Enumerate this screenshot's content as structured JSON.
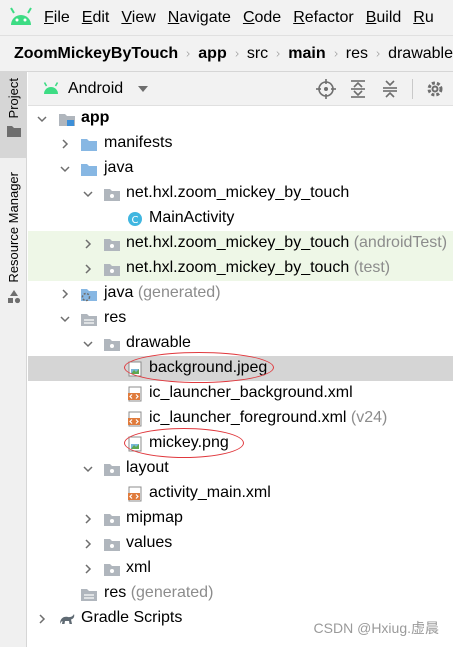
{
  "menubar": {
    "items": [
      {
        "mnemonic": "F",
        "rest": "ile"
      },
      {
        "mnemonic": "E",
        "rest": "dit"
      },
      {
        "mnemonic": "V",
        "rest": "iew"
      },
      {
        "mnemonic": "N",
        "rest": "avigate"
      },
      {
        "mnemonic": "C",
        "rest": "ode"
      },
      {
        "mnemonic": "R",
        "rest": "efactor"
      },
      {
        "mnemonic": "B",
        "rest": "uild"
      },
      {
        "mnemonic": "R",
        "rest": "u"
      }
    ]
  },
  "breadcrumb": [
    "ZoomMickeyByTouch",
    "app",
    "src",
    "main",
    "res",
    "drawable"
  ],
  "sidebar": {
    "project_label": "Project",
    "resource_label": "Resource Manager"
  },
  "toolwindow": {
    "view": "Android"
  },
  "tree": [
    {
      "label": "app",
      "hint": "",
      "icon": "module-folder-icon"
    },
    {
      "label": "manifests",
      "hint": "",
      "icon": "folder-icon"
    },
    {
      "label": "java",
      "hint": "",
      "icon": "folder-icon"
    },
    {
      "label": "net.hxl.zoom_mickey_by_touch",
      "hint": "",
      "icon": "package-icon"
    },
    {
      "label": "MainActivity",
      "hint": "",
      "icon": "class-icon"
    },
    {
      "label": "net.hxl.zoom_mickey_by_touch",
      "hint": "(androidTest)",
      "icon": "package-icon"
    },
    {
      "label": "net.hxl.zoom_mickey_by_touch",
      "hint": "(test)",
      "icon": "package-icon"
    },
    {
      "label": "java",
      "hint": "(generated)",
      "icon": "generated-folder-icon"
    },
    {
      "label": "res",
      "hint": "",
      "icon": "resource-folder-icon"
    },
    {
      "label": "drawable",
      "hint": "",
      "icon": "package-icon"
    },
    {
      "label": "background.jpeg",
      "hint": "",
      "icon": "image-file-icon"
    },
    {
      "label": "ic_launcher_background.xml",
      "hint": "",
      "icon": "xml-file-icon"
    },
    {
      "label": "ic_launcher_foreground.xml",
      "hint": "(v24)",
      "icon": "xml-file-icon"
    },
    {
      "label": "mickey.png",
      "hint": "",
      "icon": "image-file-icon"
    },
    {
      "label": "layout",
      "hint": "",
      "icon": "package-icon"
    },
    {
      "label": "activity_main.xml",
      "hint": "",
      "icon": "xml-file-icon"
    },
    {
      "label": "mipmap",
      "hint": "",
      "icon": "package-icon"
    },
    {
      "label": "values",
      "hint": "",
      "icon": "package-icon"
    },
    {
      "label": "xml",
      "hint": "",
      "icon": "package-icon"
    },
    {
      "label": "res",
      "hint": "(generated)",
      "icon": "resource-folder-icon"
    },
    {
      "label": "Gradle Scripts",
      "hint": "",
      "icon": "gradle-icon"
    }
  ],
  "watermark": "CSDN @Hxiug.虚晨",
  "colors": {
    "folder_blue": "#87b7e3",
    "folder_gray": "#b0b6bd",
    "class_cyan": "#40b6e0",
    "xml_orange": "#e07b3c",
    "annotation_red": "#e0393e",
    "test_row_green": "#eef7e7",
    "selection_gray": "#d5d5d5"
  }
}
